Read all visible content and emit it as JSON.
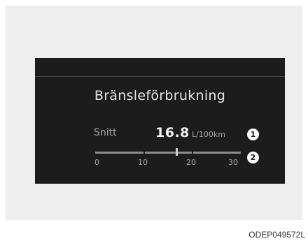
{
  "display": {
    "title": "Bränsleförbrukning",
    "average_label": "Snitt",
    "average_value": "16.8",
    "unit": "L/100km",
    "gauge": {
      "min": 0,
      "max": 30,
      "value": 16.8,
      "scale_labels": [
        "0",
        "10",
        "20",
        "30"
      ]
    },
    "callouts": [
      "1",
      "2"
    ]
  },
  "figure_code": "ODEP049572L"
}
